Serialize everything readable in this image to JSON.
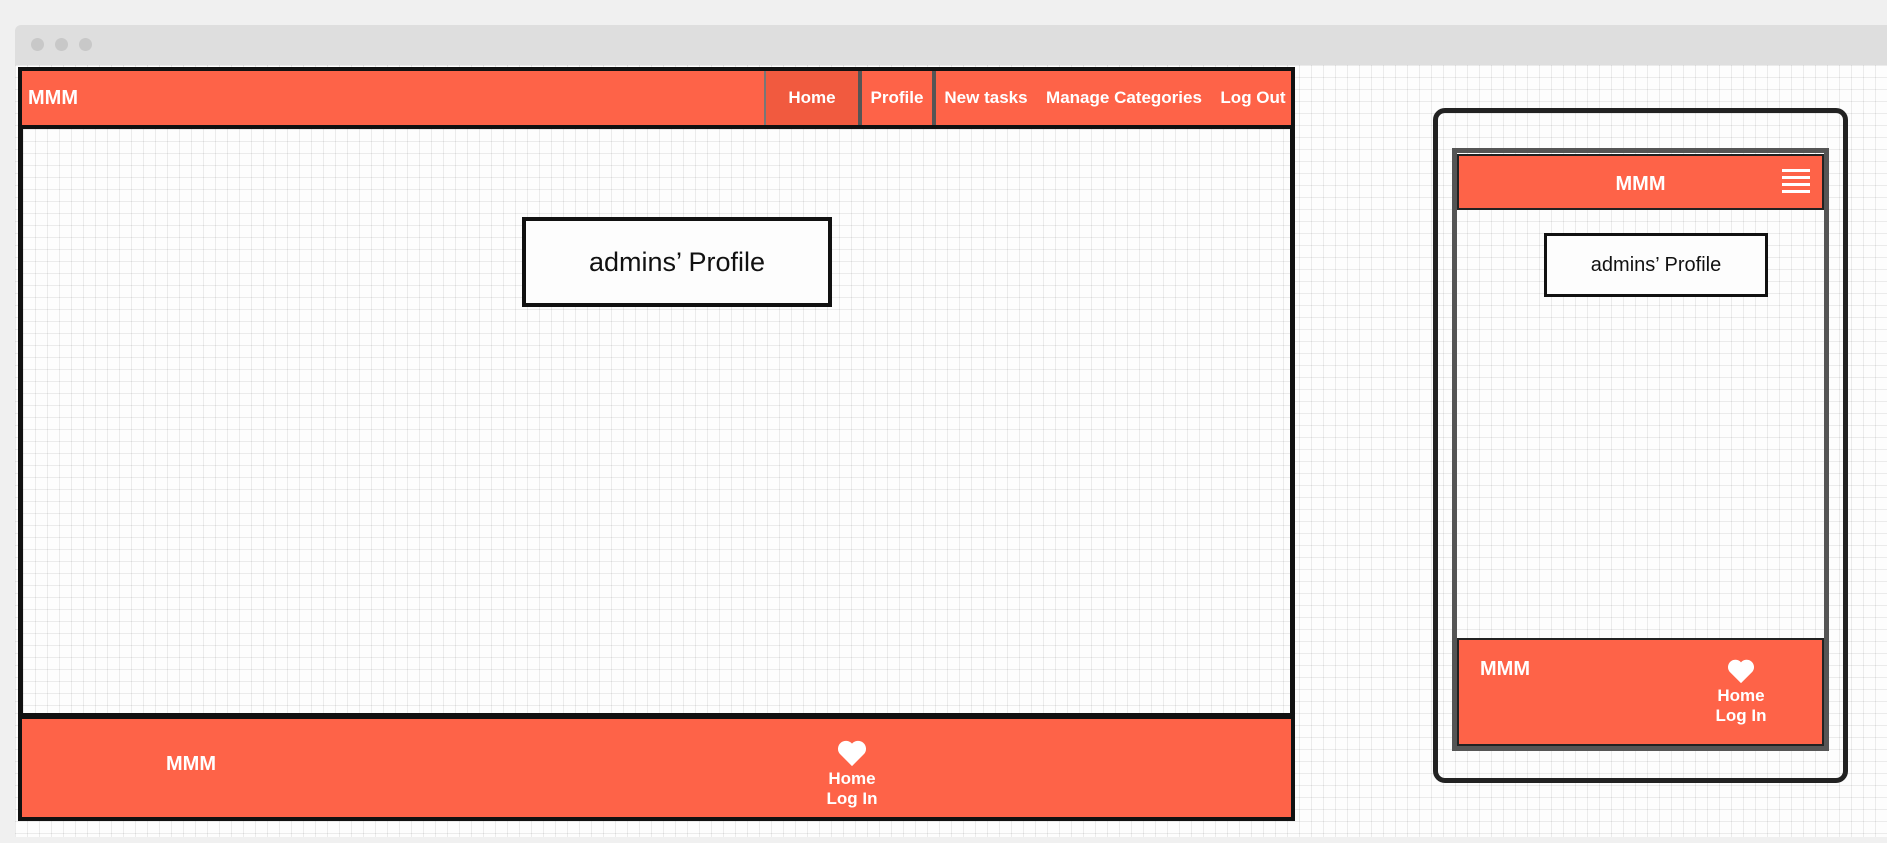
{
  "desktop": {
    "navbar": {
      "brand": "MMM",
      "items": [
        {
          "label": "Home"
        },
        {
          "label": "Profile"
        },
        {
          "label": "New tasks"
        },
        {
          "label": "Manage Categories"
        },
        {
          "label": "Log Out"
        }
      ]
    },
    "main": {
      "title": "admins’ Profile"
    },
    "footer": {
      "brand": "MMM",
      "icon": "heart-icon",
      "links": [
        {
          "label": "Home"
        },
        {
          "label": "Log In"
        }
      ]
    }
  },
  "mobile": {
    "navbar": {
      "brand": "MMM",
      "menu_icon": "hamburger-menu-icon"
    },
    "main": {
      "title": "admins’ Profile"
    },
    "footer": {
      "brand": "MMM",
      "icon": "heart-icon",
      "links": [
        {
          "label": "Home"
        },
        {
          "label": "Log In"
        }
      ]
    }
  },
  "colors": {
    "accent": "#fe6348",
    "active_nav": "#f15a3f",
    "outline": "#111111",
    "background": "#fdfdfd"
  }
}
